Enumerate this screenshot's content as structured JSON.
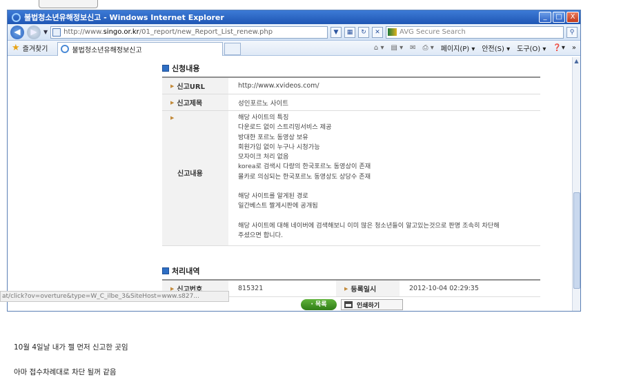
{
  "window": {
    "title": "불법청소년유해정보신고 - Windows Internet Explorer",
    "url_prefix": "http://www.",
    "url_domain": "singo.or.kr",
    "url_path": "/01_report/new_Report_List_renew.php",
    "search_placeholder": "AVG Secure Search",
    "min_glyph": "_",
    "max_glyph": "□",
    "close_glyph": "X"
  },
  "toolbar": {
    "favorites_label": "즐겨찾기",
    "tab_title": "불법청소년유해정보신고",
    "page_menu": "페이지(P) ▾",
    "safety_menu": "안전(S) ▾",
    "tools_menu": "도구(O) ▾",
    "help_menu": "❓▾"
  },
  "report": {
    "section_title": "신청내용",
    "url_label": "신고URL",
    "url_value": "http://www.xvideos.com/",
    "subject_label": "신고제목",
    "subject_value": "성인포르노 사이트",
    "content_label": "신고내용",
    "content_lines": [
      "해당 사이트의 특징",
      "다운로드 없이 스트리밍서비스 제공",
      "방대한 포르노 동영상 보유",
      "회원가입 없이 누구나 시청가능",
      "모자이크 처리 없음",
      "korea로 검색시 다량의 한국포르노 동영상이 존재",
      "몰카로 의심되는 한국포르노 동영상도 상당수 존재",
      "",
      "해당 사이트를 알게된 경로",
      "일간베스트 짤게시판에 공개됨",
      "",
      "해당 사이트에 대해 네이버에 검색해보니 이미 많은 청소년들이 알고있는것으로 판명 조속히 차단해",
      "주셨으면 합니다."
    ]
  },
  "processing": {
    "section_title": "처리내역",
    "number_label": "신고번호",
    "number_value": "815321",
    "date_label": "등록일시",
    "date_value": "2012-10-04 02:29:35"
  },
  "footer": {
    "status_text": "at/click?ov=overture&type=W_C_ilbe_3&SiteHost=www.s827...",
    "list_button": "· 목록",
    "print_button": "인쇄하기"
  },
  "captions": {
    "line1": "10월 4일날 내가  젤 먼저 신고한 곳임",
    "line2": "아마 접수차례대로 차단 될꺼 같음"
  }
}
